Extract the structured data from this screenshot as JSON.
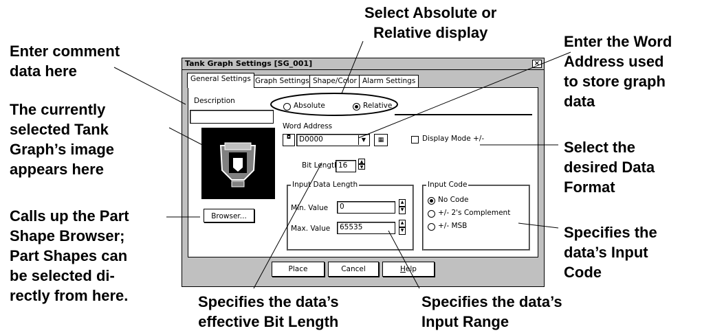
{
  "callouts": {
    "select_display": "Select Absolute or\nRelative display",
    "enter_comment": "Enter comment\ndata here",
    "current_image": "The currently\nselected Tank\nGraph’s image\nappears here",
    "calls_browser": "Calls up the Part\nShape Browser;\nPart Shapes can\nbe selected di-\nrectly from here.",
    "word_address": "Enter the Word\nAddress used\nto store graph\ndata",
    "data_format": "Select the\ndesired Data\nFormat",
    "input_code": "Specifies the\ndata’s Input\nCode",
    "bit_length": "Specifies the data’s\neffective Bit Length",
    "input_range": "Specifies the data’s\nInput Range"
  },
  "dialog": {
    "title": "Tank Graph Settings [SG_001]",
    "close_glyph": "×",
    "tabs": [
      {
        "label": "General Settings"
      },
      {
        "label": "Graph Settings"
      },
      {
        "label": "Shape/Color"
      },
      {
        "label": "Alarm Settings"
      }
    ],
    "description": {
      "label": "Description",
      "value": ""
    },
    "display_mode": {
      "options": [
        {
          "label": "Absolute",
          "selected": false
        },
        {
          "label": "Relative",
          "selected": true
        }
      ]
    },
    "word_address": {
      "label": "Word Address",
      "value": "D0000"
    },
    "display_mode_check": {
      "label": "Display Mode +/-",
      "checked": false
    },
    "bit_length": {
      "label": "Bit Length",
      "value": "16"
    },
    "input_data_length": {
      "title": "Input Data Length",
      "min_label": "Min. Value",
      "min_value": "0",
      "max_label": "Max. Value",
      "max_value": "65535"
    },
    "input_code": {
      "title": "Input Code",
      "options": [
        {
          "label": "No Code",
          "selected": true
        },
        {
          "label": "+/- 2's Complement",
          "selected": false
        },
        {
          "label": "+/- MSB",
          "selected": false
        }
      ]
    },
    "browser_button": "Browser...",
    "place_button": "Place",
    "cancel_button": "Cancel",
    "help_button": {
      "first": "H",
      "rest": "elp"
    }
  },
  "colors": {
    "dialog_bg": "#c0c0c0",
    "panel_bg": "#ffffff",
    "preview_bg": "#000000"
  },
  "icons": [
    "close-icon",
    "address-input-icon",
    "dropdown-arrow-icon",
    "keypad-icon",
    "tank-graph-image",
    "spin-up-icon",
    "spin-down-icon"
  ]
}
